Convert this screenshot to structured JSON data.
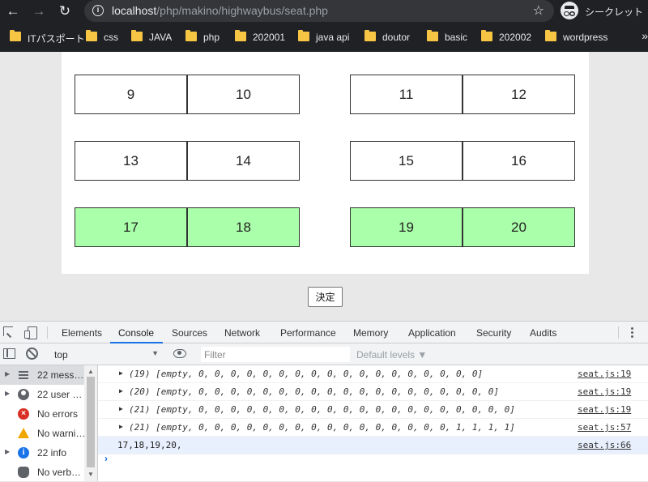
{
  "browser": {
    "url_host": "localhost",
    "url_path": "/php/makino/highwaybus/seat.php",
    "incognito_label": "シークレット",
    "bookmarks": [
      "ITパスポート",
      "css",
      "JAVA",
      "php",
      "202001",
      "java api",
      "doutor",
      "basic",
      "202002",
      "wordpress"
    ]
  },
  "seats": [
    {
      "number": "9",
      "reserved": false
    },
    {
      "number": "10",
      "reserved": false
    },
    {
      "number": "11",
      "reserved": false
    },
    {
      "number": "12",
      "reserved": false
    },
    {
      "number": "13",
      "reserved": false
    },
    {
      "number": "14",
      "reserved": false
    },
    {
      "number": "15",
      "reserved": false
    },
    {
      "number": "16",
      "reserved": false
    },
    {
      "number": "17",
      "reserved": true
    },
    {
      "number": "18",
      "reserved": true
    },
    {
      "number": "19",
      "reserved": true
    },
    {
      "number": "20",
      "reserved": true
    }
  ],
  "colors": {
    "reserved_seat": "#aaffaa",
    "accent": "#1a73e8"
  },
  "submit_label": "決定",
  "devtools": {
    "tabs": [
      "Elements",
      "Console",
      "Sources",
      "Network",
      "Performance",
      "Memory",
      "Application",
      "Security",
      "Audits"
    ],
    "active_tab": "Console",
    "context": "top",
    "filter_placeholder": "Filter",
    "levels_label": "Default levels ▼",
    "sidebar": [
      {
        "label": "22 mess…",
        "icon": "list-icon",
        "expandable": true,
        "selected": true
      },
      {
        "label": "22 user …",
        "icon": "user-icon",
        "expandable": true,
        "selected": false
      },
      {
        "label": "No errors",
        "icon": "error-icon",
        "expandable": false,
        "selected": false
      },
      {
        "label": "No warni…",
        "icon": "warning-icon",
        "expandable": false,
        "selected": false
      },
      {
        "label": "22 info",
        "icon": "info-icon",
        "expandable": true,
        "selected": false
      },
      {
        "label": "No verb…",
        "icon": "bug-icon",
        "expandable": false,
        "selected": false
      }
    ],
    "logs": [
      {
        "text": "(19) [empty, 0, 0, 0, 0, 0, 0, 0, 0, 0, 0, 0, 0, 0, 0, 0, 0, 0, 0]",
        "source": "seat.js:19",
        "expandable": true
      },
      {
        "text": "(20) [empty, 0, 0, 0, 0, 0, 0, 0, 0, 0, 0, 0, 0, 0, 0, 0, 0, 0, 0, 0]",
        "source": "seat.js:19",
        "expandable": true
      },
      {
        "text": "(21) [empty, 0, 0, 0, 0, 0, 0, 0, 0, 0, 0, 0, 0, 0, 0, 0, 0, 0, 0, 0, 0]",
        "source": "seat.js:19",
        "expandable": true
      },
      {
        "text": "(21) [empty, 0, 0, 0, 0, 0, 0, 0, 0, 0, 0, 0, 0, 0, 0, 0, 0, 1, 1, 1, 1]",
        "source": "seat.js:57",
        "expandable": true
      },
      {
        "text": "17,18,19,20,",
        "source": "seat.js:66",
        "expandable": false
      }
    ]
  }
}
